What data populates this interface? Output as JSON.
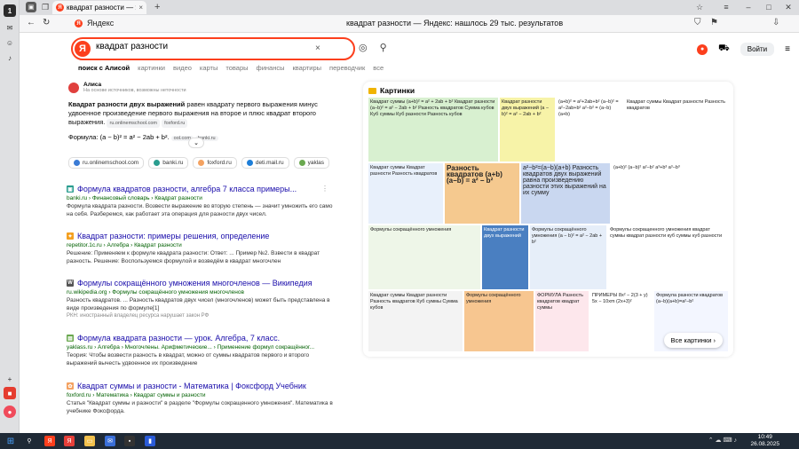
{
  "browser": {
    "tab_title": "квадрат разности — Я",
    "tab_close": "×",
    "new_tab": "+",
    "address_site": "Яндекс",
    "page_title": "квадрат разности — Яндекс: нашлось 29 тыс. результатов",
    "sidebar_badge": "1"
  },
  "search": {
    "query": "квадрат разности",
    "logo": "Я",
    "clear": "×",
    "login": "Войти"
  },
  "services": [
    "поиск с Алисой",
    "картинки",
    "видео",
    "карты",
    "товары",
    "финансы",
    "квартиры",
    "переводчик",
    "все"
  ],
  "alice": {
    "name": "Алиса",
    "note": "На основе источников, возможны неточности",
    "text_bold": "Квадрат разности двух выражений",
    "text": " равен квадрату первого выражения минус удвоенное произведение первого выражения на второе и плюс квадрат второго выражения.",
    "src1": "ru.onlinemschool.com",
    "src2": "foxford.ru",
    "formula_label": "Формула: (a − b)² = a² − 2ab + b².",
    "src3": "ool.com",
    "src4": "banki.ru",
    "chips": [
      {
        "label": "ru.onlinemschool.com",
        "color": "#3a7bd5"
      },
      {
        "label": "banki.ru",
        "color": "#2a9d8f"
      },
      {
        "label": "foxford.ru",
        "color": "#f4a261"
      },
      {
        "label": "deti.mail.ru",
        "color": "#1d7ed8"
      },
      {
        "label": "yaklas",
        "color": "#6aa84f"
      }
    ]
  },
  "results": [
    {
      "title": "Формула квадратов разности, алгебра 7 класса примеры...",
      "url": "banki.ru › Финансовый словарь › Квадрат разности",
      "desc": "Формула квадрата разности. Возвести выражение во вторую степень — значит умножить его само на себя. Разберемся, как работает эта операция для разности двух чисел.",
      "meta": "",
      "fav_color": "#2a9d8f"
    },
    {
      "title": "Квадрат разности: примеры решения, определение",
      "url": "repetitor.1c.ru › Алгебра › Квадрат разности",
      "desc": "Решение: Применяем к формуле квадрата разности: Ответ: ... Пример №2. Взвести в квадрат разность. Решение: Воспользуемся формулой и возведём в квадрат многочлен",
      "meta": "",
      "fav_color": "#f4a020"
    },
    {
      "title": "Формулы сокращённого умножения многочленов — Википедия",
      "url": "ru.wikipedia.org › Формулы сокращённого умножения многочленов",
      "desc": "Разность квадратов. ... Разность квадратов двух чисел (многочленов) может быть представлена в виде произведения по формуле[1]",
      "meta": "РКН: иностранный владелец ресурса нарушает закон РФ",
      "fav_color": "#555555"
    },
    {
      "title": "Формула квадрата разности — урок. Алгебра, 7 класс.",
      "url": "yaklass.ru › Алгебра › Многочлены. Арифметические... › Применение формул сокращённог...",
      "desc": "Теория: Чтобы возвести разность в квадрат, можно от суммы квадратов первого и второго выражений вычесть удвоенное их произведение",
      "meta": "",
      "fav_color": "#6aa84f"
    },
    {
      "title": "Квадрат суммы и разности - Математика | Фоксфорд Учебник",
      "url": "foxford.ru › Математика › Квадрат суммы и разности",
      "desc": "Статья \"Квадрат суммы и разности\" в разделе \"Формулы сокращенного умножения\". Математика в учебнике Фоксфорда.",
      "meta": "",
      "fav_color": "#f4a261"
    }
  ],
  "images": {
    "title": "Картинки",
    "all_label": "Все картинки",
    "thumbs": [
      {
        "text": "Квадрат суммы (a+b)² = a² + 2ab + b²  Квадрат разности (a−b)² = a² − 2ab + b²  Разность квадратов  Сумма кубов  Куб суммы  Куб разности  Разность кубов",
        "bg": "#d8f0d0"
      },
      {
        "text": "Квадрат разности двух выражений  (a − b)² = a² − 2ab + b²",
        "bg": "#f7f3a8"
      },
      {
        "text": "(a+b)² = a²+2ab+b²  (a−b)² = a²−2ab+b²  a²−b² = (a−b)(a+b)",
        "bg": "#ffffff"
      },
      {
        "text": "Квадрат суммы  Квадрат разности  Разность квадратов",
        "bg": "#e8f0fb"
      },
      {
        "text": "Разность квадратов  (a+b)(a−b) = a² − b²",
        "bg": "#f5c98f"
      },
      {
        "text": "a²−b²=(a−b)(a+b)  Разность квадратов двух выражений равна произведению разности этих выражений на их сумму",
        "bg": "#c9d7f0"
      },
      {
        "text": "(a+b)²  (a−b)²  a²−b²  a³+b³  a³−b³",
        "bg": "#ffffff"
      },
      {
        "text": "Формулы сокращённого умножения",
        "bg": "#eef6e8"
      },
      {
        "text": "Квадрат разности двух выражений",
        "bg": "#4a7fc1"
      },
      {
        "text": "Формулы сокращённого умножения  (a − b)² = a² − 2ab + b²",
        "bg": "#e6eef9"
      },
      {
        "text": "Формулы сокращенного умножения  квадрат суммы  квадрат разности  куб суммы  куб разности",
        "bg": "#ffffff"
      },
      {
        "text": "Квадрат суммы  Квадрат разности  Разность квадратов  Куб суммы  Сумма кубов",
        "bg": "#f3f3f3"
      },
      {
        "text": "Формулы сокращённого умножения",
        "bg": "#f7c690"
      },
      {
        "text": "ФОРМУЛА  Разность квадратов  квадрат суммы",
        "bg": "#fde7ec"
      },
      {
        "text": "ПРИМЕРЫ  8x² − 2(3 + y)  5x − 10xm  (2x+3)²",
        "bg": "#ffffff"
      },
      {
        "text": "Формула разности квадратов  (a−b)(a+b)=a²−b²",
        "bg": "#f3f6ff"
      }
    ]
  },
  "taskbar": {
    "time": "10:49",
    "date": "26.08.2025"
  }
}
